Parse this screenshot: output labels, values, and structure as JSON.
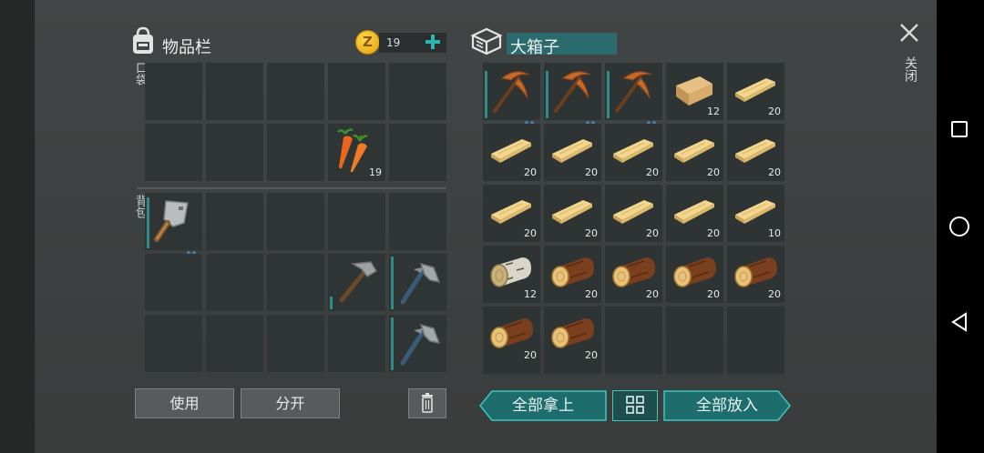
{
  "inventory": {
    "title": "物品栏",
    "coins": "19",
    "pocket_label": "口袋",
    "backpack_label": "背包",
    "pocket_slots": [
      {
        "item": "",
        "count": ""
      },
      {
        "item": "",
        "count": ""
      },
      {
        "item": "",
        "count": ""
      },
      {
        "item": "",
        "count": ""
      },
      {
        "item": "",
        "count": ""
      },
      {
        "item": "",
        "count": ""
      },
      {
        "item": "",
        "count": ""
      },
      {
        "item": "",
        "count": ""
      },
      {
        "item": "carrot-icon",
        "count": "19"
      },
      {
        "item": "",
        "count": ""
      }
    ],
    "backpack_slots": [
      {
        "item": "cleaver-icon",
        "count": ""
      },
      {
        "item": "",
        "count": ""
      },
      {
        "item": "",
        "count": ""
      },
      {
        "item": "",
        "count": ""
      },
      {
        "item": "",
        "count": ""
      },
      {
        "item": "",
        "count": ""
      },
      {
        "item": "",
        "count": ""
      },
      {
        "item": "",
        "count": ""
      },
      {
        "item": "hammer-icon",
        "count": ""
      },
      {
        "item": "axe-icon",
        "count": ""
      },
      {
        "item": "",
        "count": ""
      },
      {
        "item": "",
        "count": ""
      },
      {
        "item": "",
        "count": ""
      },
      {
        "item": "",
        "count": ""
      },
      {
        "item": "axe-icon",
        "count": ""
      }
    ],
    "use_label": "使用",
    "split_label": "分开"
  },
  "chest": {
    "title": "大箱子",
    "close_label": "关闭",
    "slots": [
      {
        "item": "pickaxe-icon",
        "count": ""
      },
      {
        "item": "pickaxe-icon",
        "count": ""
      },
      {
        "item": "pickaxe-icon",
        "count": ""
      },
      {
        "item": "log-beam-icon",
        "count": "12"
      },
      {
        "item": "plank-icon",
        "count": "20"
      },
      {
        "item": "plank-icon",
        "count": "20"
      },
      {
        "item": "plank-icon",
        "count": "20"
      },
      {
        "item": "plank-icon",
        "count": "20"
      },
      {
        "item": "plank-icon",
        "count": "20"
      },
      {
        "item": "plank-icon",
        "count": "20"
      },
      {
        "item": "plank-icon",
        "count": "20"
      },
      {
        "item": "plank-icon",
        "count": "20"
      },
      {
        "item": "plank-icon",
        "count": "20"
      },
      {
        "item": "plank-icon",
        "count": "20"
      },
      {
        "item": "plank-icon",
        "count": "10"
      },
      {
        "item": "birch-log-icon",
        "count": "12"
      },
      {
        "item": "log-icon",
        "count": "20"
      },
      {
        "item": "log-icon",
        "count": "20"
      },
      {
        "item": "log-icon",
        "count": "20"
      },
      {
        "item": "log-icon",
        "count": "20"
      },
      {
        "item": "log-icon",
        "count": "20"
      },
      {
        "item": "log-icon",
        "count": "20"
      },
      {
        "item": "",
        "count": ""
      },
      {
        "item": "",
        "count": ""
      },
      {
        "item": "",
        "count": ""
      }
    ],
    "take_all_label": "全部拿上",
    "put_all_label": "全部放入"
  }
}
